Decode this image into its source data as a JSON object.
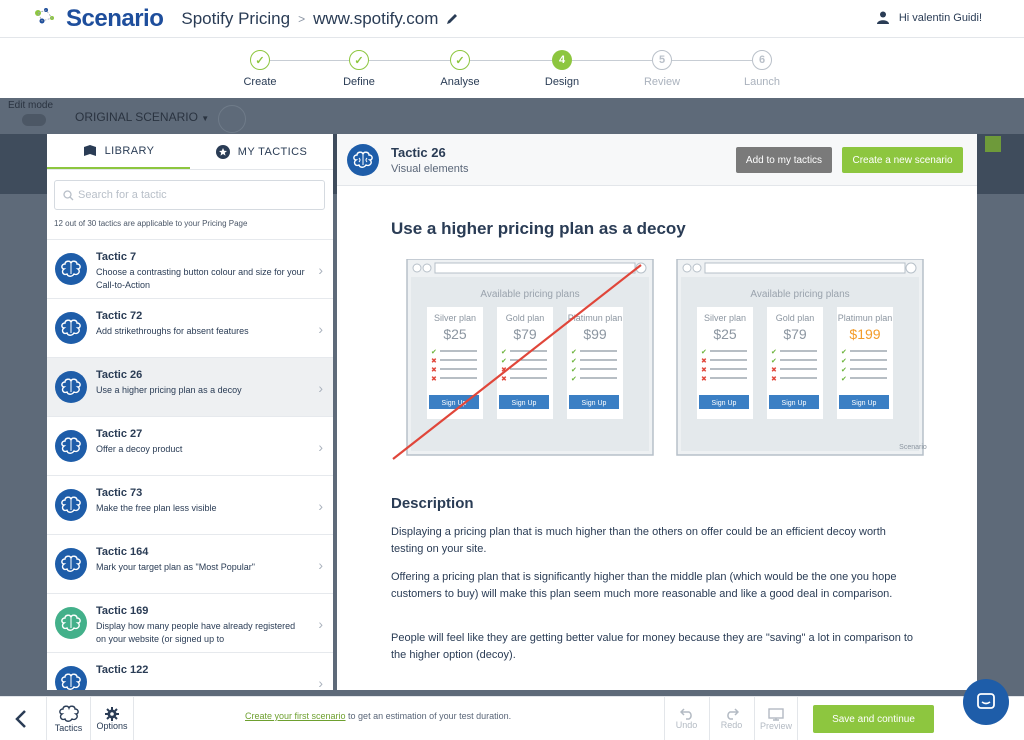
{
  "header": {
    "logo_text": "Scenario",
    "project_name": "Spotify Pricing",
    "separator": ">",
    "site_url": "www.spotify.com",
    "user_greeting": "Hi valentin Guidi!"
  },
  "steps": [
    {
      "label": "Create",
      "state": "done",
      "number": "1"
    },
    {
      "label": "Define",
      "state": "done",
      "number": "2"
    },
    {
      "label": "Analyse",
      "state": "done",
      "number": "3"
    },
    {
      "label": "Design",
      "state": "active",
      "number": "4"
    },
    {
      "label": "Review",
      "state": "todo",
      "number": "5"
    },
    {
      "label": "Launch",
      "state": "todo",
      "number": "6"
    }
  ],
  "background": {
    "edit_mode": "Edit mode",
    "scenario_select": "ORIGINAL SCENARIO"
  },
  "left_panel": {
    "tabs": [
      {
        "label": "LIBRARY",
        "active": true
      },
      {
        "label": "MY TACTICS",
        "active": false
      }
    ],
    "search_placeholder": "Search for a tactic",
    "applicable_count": "12 out of 30 tactics are applicable to your Pricing Page",
    "tactics": [
      {
        "title": "Tactic 7",
        "desc": "Choose a contrasting button colour and size for your Call-to-Action",
        "selected": false,
        "icon_color": "blue"
      },
      {
        "title": "Tactic 72",
        "desc": "Add strikethroughs for absent features",
        "selected": false,
        "icon_color": "blue"
      },
      {
        "title": "Tactic 26",
        "desc": "Use a higher pricing plan as a decoy",
        "selected": true,
        "icon_color": "blue"
      },
      {
        "title": "Tactic 27",
        "desc": "Offer a decoy product",
        "selected": false,
        "icon_color": "blue"
      },
      {
        "title": "Tactic 73",
        "desc": "Make the free plan less visible",
        "selected": false,
        "icon_color": "blue"
      },
      {
        "title": "Tactic 164",
        "desc": "Mark your target plan as \"Most Popular\"",
        "selected": false,
        "icon_color": "blue"
      },
      {
        "title": "Tactic 169",
        "desc": "Display how many people have already registered on your website (or signed up to",
        "selected": false,
        "icon_color": "teal"
      },
      {
        "title": "Tactic 122",
        "desc": "",
        "selected": false,
        "icon_color": "blue"
      }
    ]
  },
  "detail": {
    "tactic_title": "Tactic 26",
    "category": "Visual elements",
    "add_button": "Add to my tactics",
    "create_button": "Create a new scenario",
    "heading": "Use a higher pricing plan as a decoy",
    "illustration": {
      "panel_title": "Available pricing plans",
      "plans_before": [
        {
          "name": "Silver plan",
          "price": "$25"
        },
        {
          "name": "Gold plan",
          "price": "$79"
        },
        {
          "name": "Platimun plan",
          "price": "$99"
        }
      ],
      "plans_after": [
        {
          "name": "Silver plan",
          "price": "$25"
        },
        {
          "name": "Gold plan",
          "price": "$79"
        },
        {
          "name": "Platimun plan",
          "price": "$199"
        }
      ],
      "signup": "Sign Up",
      "watermark": "Scenario"
    },
    "description_heading": "Description",
    "paragraphs": [
      "Displaying a pricing plan that is much higher than the others on offer could be an efficient decoy worth testing on your site.",
      "Offering a pricing plan that is significantly higher than the middle plan (which would be the one you hope customers to buy) will make this plan seem much more reasonable and like a good deal in comparison.",
      "People will feel like they are getting better value for money because they are \"saving\" a lot in comparison to the higher option (decoy)."
    ]
  },
  "footer": {
    "tactics_label": "Tactics",
    "options_label": "Options",
    "create_link": "Create your first scenario",
    "create_rest": " to get an estimation of your test duration.",
    "undo": "Undo",
    "redo": "Redo",
    "preview": "Preview",
    "save": "Save and continue"
  },
  "colors": {
    "brand_blue": "#1e5da9",
    "accent_green": "#8dc63f",
    "decoy_orange": "#f39c2a",
    "strike_red": "#e0463a"
  }
}
